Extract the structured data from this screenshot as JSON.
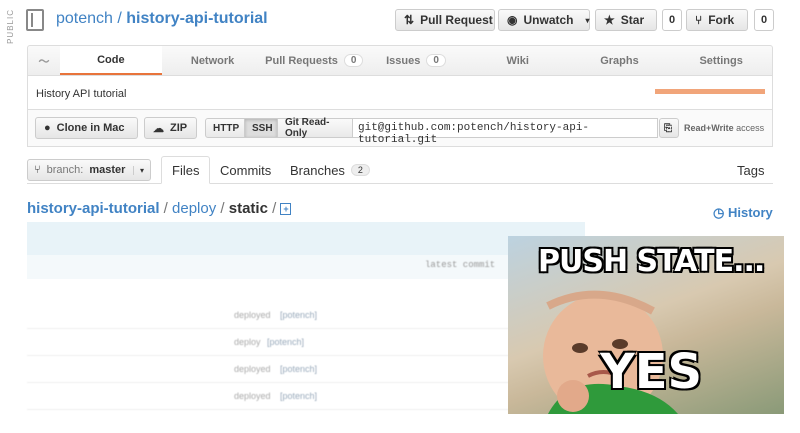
{
  "header": {
    "public_label": "PUBLIC",
    "owner": "potench",
    "separator": " / ",
    "repo": "history-api-tutorial"
  },
  "actions": {
    "pull_request": "Pull Request",
    "unwatch": "Unwatch",
    "star": "Star",
    "star_count": "0",
    "fork": "Fork",
    "fork_count": "0"
  },
  "tabs": [
    {
      "label": "Code"
    },
    {
      "label": "Network"
    },
    {
      "label": "Pull Requests",
      "count": "0"
    },
    {
      "label": "Issues",
      "count": "0"
    },
    {
      "label": "Wiki"
    },
    {
      "label": "Graphs"
    },
    {
      "label": "Settings"
    }
  ],
  "description": "History API tutorial",
  "clone": {
    "mac": "Clone in Mac",
    "zip": "ZIP",
    "https": "HTTP",
    "ssh": "SSH",
    "git_ro": "Git Read-Only",
    "url": "git@github.com:potench/history-api-tutorial.git",
    "access": "Read+Write",
    "access_suffix": " access"
  },
  "branch": {
    "prefix": "branch:",
    "name": "master"
  },
  "filetabs": {
    "files": "Files",
    "commits": "Commits",
    "branches": "Branches",
    "branches_count": "2",
    "tags": "Tags"
  },
  "breadcrumb": {
    "root": "history-api-tutorial",
    "sep1": " / ",
    "dir": "deploy",
    "sep2": " / ",
    "current": "static",
    "sep3": " / "
  },
  "history_label": "History",
  "table": {
    "header_text": "latest commit",
    "rows": [
      {
        "msg": "deployed",
        "author": "[potench]"
      },
      {
        "msg": "deploy",
        "author": "[potench]"
      },
      {
        "msg": "deployed",
        "author": "[potench]"
      },
      {
        "msg": "deployed",
        "author": "[potench]"
      }
    ]
  },
  "meme": {
    "top": "PUSH STATE...",
    "bottom": "YES"
  },
  "colors": {
    "link": "#4183c4",
    "accent": "#e8743b"
  }
}
